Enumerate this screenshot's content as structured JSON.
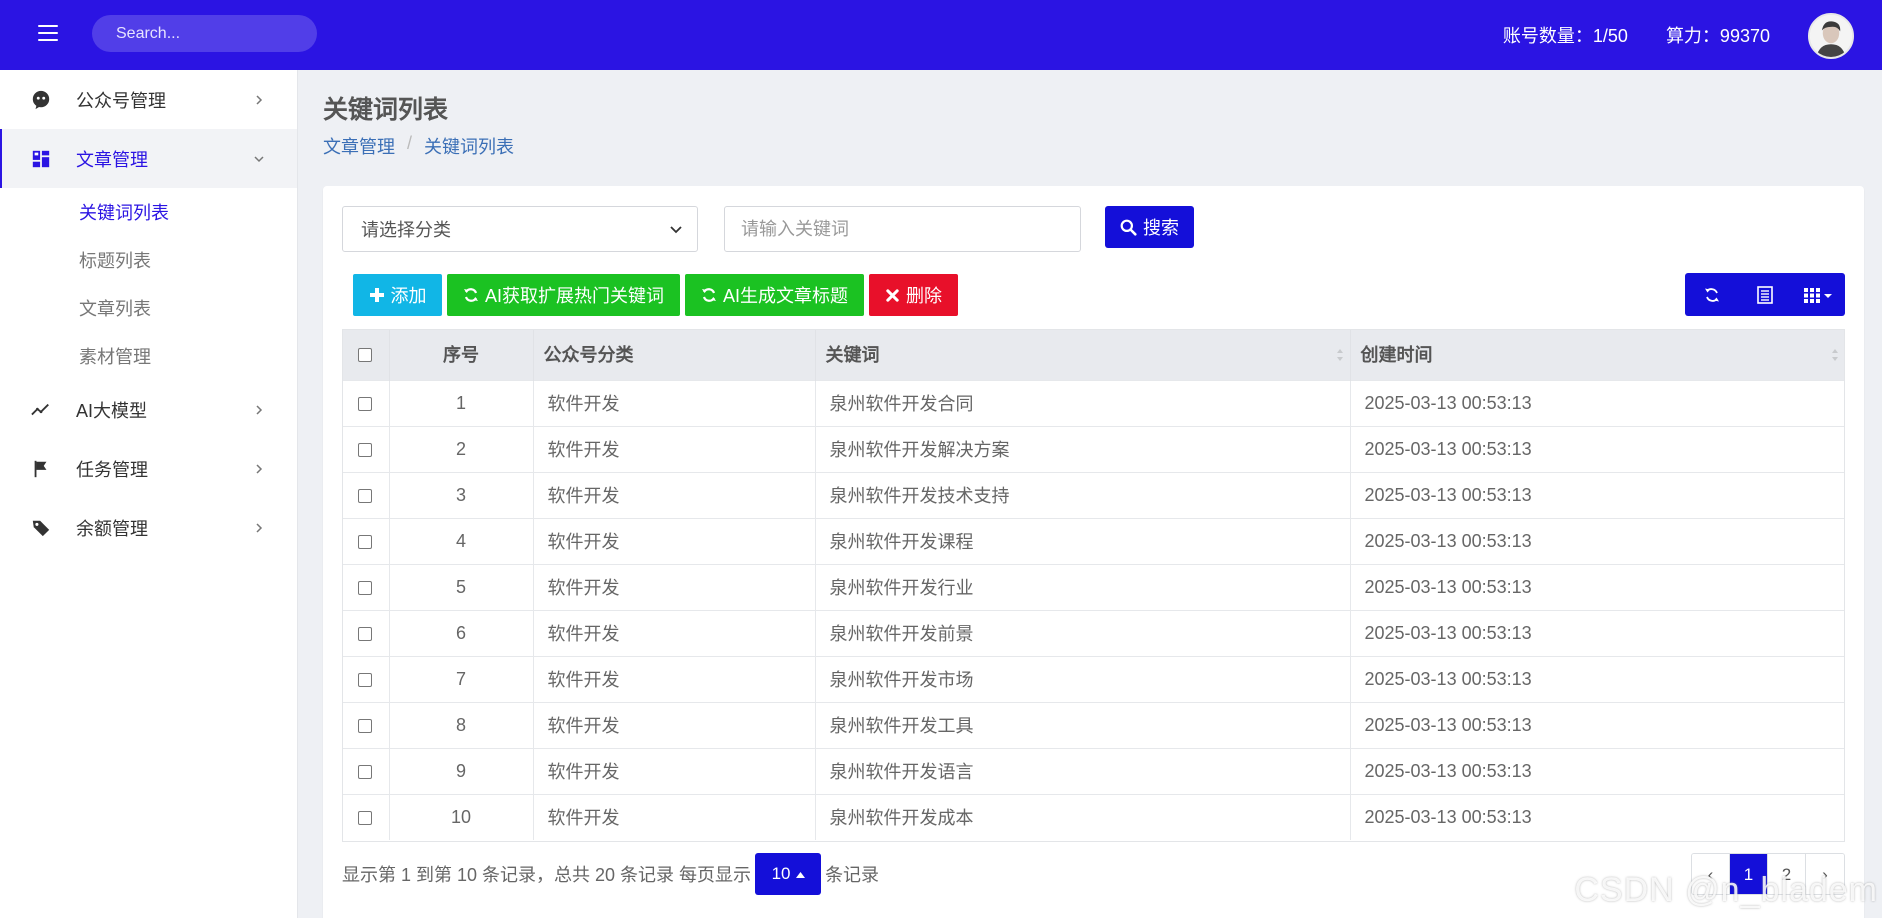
{
  "header": {
    "search_placeholder": "Search...",
    "account_count": "账号数量：1/50",
    "compute_power": "算力：99370"
  },
  "sidebar": {
    "items": [
      {
        "label": "公众号管理",
        "icon": "wechat-icon"
      },
      {
        "label": "文章管理",
        "icon": "dashboard-icon",
        "expanded": true,
        "children": [
          "关键词列表",
          "标题列表",
          "文章列表",
          "素材管理"
        ]
      },
      {
        "label": "AI大模型",
        "icon": "trend-icon"
      },
      {
        "label": "任务管理",
        "icon": "flag-icon"
      },
      {
        "label": "余额管理",
        "icon": "tag-icon"
      }
    ]
  },
  "page": {
    "title": "关键词列表",
    "breadcrumb": [
      "文章管理",
      "关键词列表"
    ]
  },
  "filters": {
    "category_selected": "请选择分类",
    "keyword_placeholder": "请输入关键词",
    "search_label": "搜索"
  },
  "toolbar": {
    "add_label": "添加",
    "ai_expand_label": "AI获取扩展热门关键词",
    "ai_title_label": "AI生成文章标题",
    "delete_label": "删除"
  },
  "table": {
    "columns": [
      "序号",
      "公众号分类",
      "关键词",
      "创建时间"
    ],
    "rows": [
      {
        "no": "1",
        "category": "软件开发",
        "keyword": "泉州软件开发合同",
        "created": "2025-03-13 00:53:13"
      },
      {
        "no": "2",
        "category": "软件开发",
        "keyword": "泉州软件开发解决方案",
        "created": "2025-03-13 00:53:13"
      },
      {
        "no": "3",
        "category": "软件开发",
        "keyword": "泉州软件开发技术支持",
        "created": "2025-03-13 00:53:13"
      },
      {
        "no": "4",
        "category": "软件开发",
        "keyword": "泉州软件开发课程",
        "created": "2025-03-13 00:53:13"
      },
      {
        "no": "5",
        "category": "软件开发",
        "keyword": "泉州软件开发行业",
        "created": "2025-03-13 00:53:13"
      },
      {
        "no": "6",
        "category": "软件开发",
        "keyword": "泉州软件开发前景",
        "created": "2025-03-13 00:53:13"
      },
      {
        "no": "7",
        "category": "软件开发",
        "keyword": "泉州软件开发市场",
        "created": "2025-03-13 00:53:13"
      },
      {
        "no": "8",
        "category": "软件开发",
        "keyword": "泉州软件开发工具",
        "created": "2025-03-13 00:53:13"
      },
      {
        "no": "9",
        "category": "软件开发",
        "keyword": "泉州软件开发语言",
        "created": "2025-03-13 00:53:13"
      },
      {
        "no": "10",
        "category": "软件开发",
        "keyword": "泉州软件开发成本",
        "created": "2025-03-13 00:53:13"
      }
    ]
  },
  "footer": {
    "summary": "显示第 1 到第 10 条记录，总共 20 条记录 每页显示",
    "page_size": "10",
    "suffix": "条记录",
    "pages": [
      "‹",
      "1",
      "2",
      "›"
    ],
    "current_page": "1"
  },
  "watermark": "CSDN @n_bladem",
  "colors": {
    "primary": "#2b14e3",
    "info": "#11b6e6",
    "success": "#1bc222",
    "danger": "#e8102a"
  }
}
